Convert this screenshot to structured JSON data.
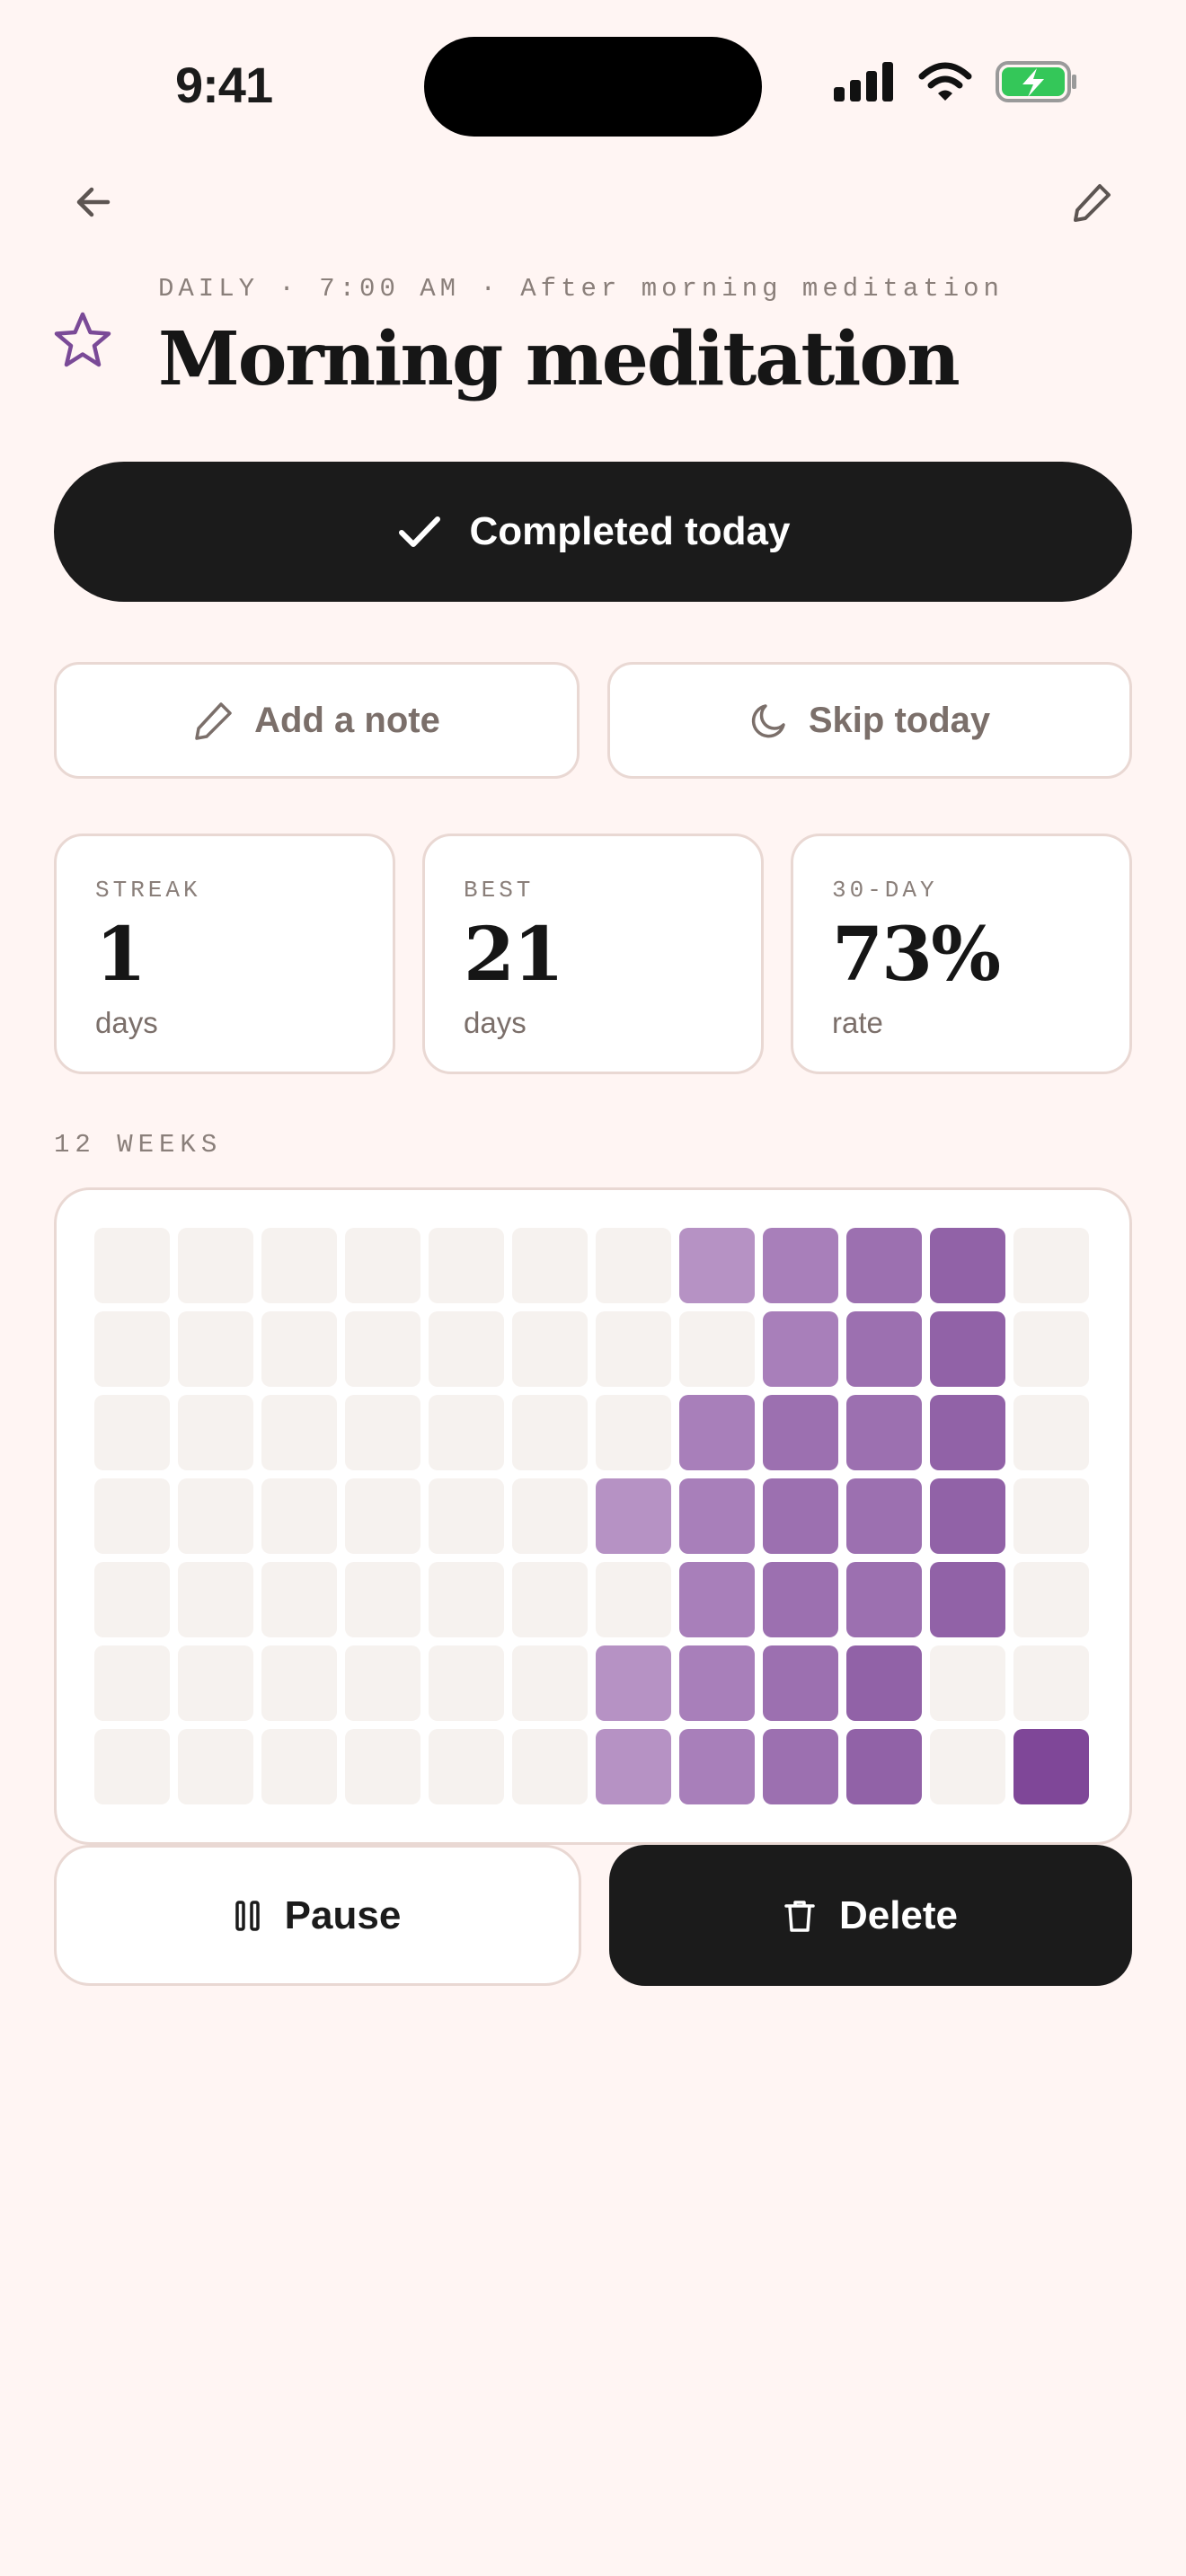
{
  "status": {
    "time": "9:41"
  },
  "habit": {
    "frequency": "DAILY",
    "time": "7:00 AM",
    "cue": "After morning meditation",
    "title": "Morning meditation"
  },
  "actions": {
    "complete_label": "Completed today",
    "note_label": "Add a note",
    "skip_label": "Skip today",
    "pause_label": "Pause",
    "delete_label": "Delete"
  },
  "stats": [
    {
      "label": "STREAK",
      "value": "1",
      "unit": "days"
    },
    {
      "label": "BEST",
      "value": "21",
      "unit": "days"
    },
    {
      "label": "30-DAY",
      "value": "73%",
      "unit": "rate"
    }
  ],
  "heatmap": {
    "label": "12 WEEKS",
    "rows": 7,
    "columns": 12,
    "empty_color": "#f6f2ef",
    "palette": [
      "#f6f2ef",
      "#b692c4",
      "#a87fba",
      "#9c70b0",
      "#9162a7",
      "#7f4798"
    ],
    "levels": [
      [
        0,
        0,
        0,
        0,
        0,
        0,
        0,
        1,
        2,
        3,
        4,
        0
      ],
      [
        0,
        0,
        0,
        0,
        0,
        0,
        0,
        0,
        2,
        3,
        4,
        0
      ],
      [
        0,
        0,
        0,
        0,
        0,
        0,
        0,
        2,
        3,
        3,
        4,
        0
      ],
      [
        0,
        0,
        0,
        0,
        0,
        0,
        1,
        2,
        3,
        3,
        4,
        0
      ],
      [
        0,
        0,
        0,
        0,
        0,
        0,
        0,
        2,
        3,
        3,
        4,
        0
      ],
      [
        0,
        0,
        0,
        0,
        0,
        0,
        1,
        2,
        3,
        4,
        0,
        0
      ],
      [
        0,
        0,
        0,
        0,
        0,
        0,
        1,
        2,
        3,
        4,
        0,
        5
      ]
    ]
  },
  "colors": {
    "background": "#fff5f3",
    "primary": "#1b1b1b",
    "accent": "#7a4a97",
    "border": "#e9d8d3",
    "battery": "#34c759"
  },
  "icons": {
    "back": "arrow-left-icon",
    "edit": "pencil-icon",
    "favorite": "star-outline-icon",
    "check": "check-icon",
    "note": "pencil-icon",
    "skip": "moon-icon",
    "pause": "pause-icon",
    "delete": "trash-icon"
  }
}
